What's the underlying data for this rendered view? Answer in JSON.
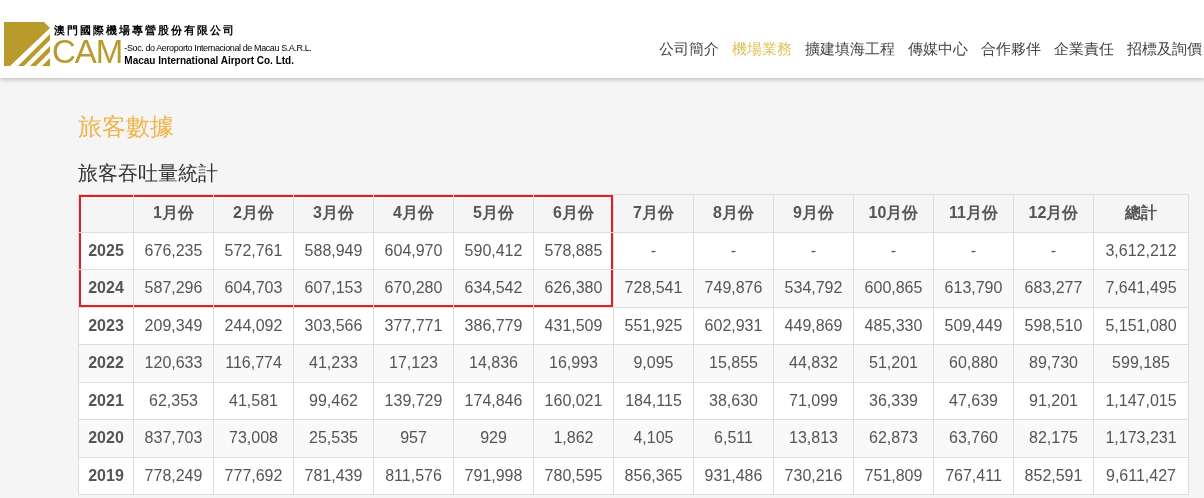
{
  "logo": {
    "chinese_name": "澳門國際機場專營股份有限公司",
    "letters": "CAM",
    "portuguese_name": "-Soc. do Aeroporto Internacional de Macau S.A.R.L.",
    "english_name": "Macau International Airport Co. Ltd."
  },
  "nav": [
    {
      "label": "公司簡介",
      "selected": false
    },
    {
      "label": "機場業務",
      "selected": true
    },
    {
      "label": "擴建填海工程",
      "selected": false
    },
    {
      "label": "傳媒中心",
      "selected": false
    },
    {
      "label": "合作夥伴",
      "selected": false
    },
    {
      "label": "企業責任",
      "selected": false
    },
    {
      "label": "招標及詢價",
      "selected": false
    }
  ],
  "page_title": "旅客數據",
  "section_title": "旅客吞吐量統計",
  "table": {
    "columns": [
      {
        "label": "1月份",
        "highlighted": true
      },
      {
        "label": "2月份",
        "highlighted": true
      },
      {
        "label": "3月份",
        "highlighted": true
      },
      {
        "label": "4月份",
        "highlighted": true
      },
      {
        "label": "5月份",
        "highlighted": true
      },
      {
        "label": "6月份",
        "highlighted": true
      },
      {
        "label": "7月份",
        "highlighted": false
      },
      {
        "label": "8月份",
        "highlighted": false
      },
      {
        "label": "9月份",
        "highlighted": false
      },
      {
        "label": "10月份",
        "highlighted": false
      },
      {
        "label": "11月份",
        "highlighted": false
      },
      {
        "label": "12月份",
        "highlighted": false
      },
      {
        "label": "總計",
        "highlighted": false
      }
    ],
    "rows": [
      {
        "year": "2025",
        "highlighted": true,
        "cells": [
          "676,235",
          "572,761",
          "588,949",
          "604,970",
          "590,412",
          "578,885",
          "-",
          "-",
          "-",
          "-",
          "-",
          "-",
          "3,612,212"
        ]
      },
      {
        "year": "2024",
        "highlighted": true,
        "cells": [
          "587,296",
          "604,703",
          "607,153",
          "670,280",
          "634,542",
          "626,380",
          "728,541",
          "749,876",
          "534,792",
          "600,865",
          "613,790",
          "683,277",
          "7,641,495"
        ]
      },
      {
        "year": "2023",
        "highlighted": false,
        "cells": [
          "209,349",
          "244,092",
          "303,566",
          "377,771",
          "386,779",
          "431,509",
          "551,925",
          "602,931",
          "449,869",
          "485,330",
          "509,449",
          "598,510",
          "5,151,080"
        ]
      },
      {
        "year": "2022",
        "highlighted": false,
        "cells": [
          "120,633",
          "116,774",
          "41,233",
          "17,123",
          "14,836",
          "16,993",
          "9,095",
          "15,855",
          "44,832",
          "51,201",
          "60,880",
          "89,730",
          "599,185"
        ]
      },
      {
        "year": "2021",
        "highlighted": false,
        "cells": [
          "62,353",
          "41,581",
          "99,462",
          "139,729",
          "174,846",
          "160,021",
          "184,115",
          "38,630",
          "71,099",
          "36,339",
          "47,639",
          "91,201",
          "1,147,015"
        ]
      },
      {
        "year": "2020",
        "highlighted": false,
        "cells": [
          "837,703",
          "73,008",
          "25,535",
          "957",
          "929",
          "1,862",
          "4,105",
          "6,511",
          "13,813",
          "62,873",
          "63,760",
          "82,175",
          "1,173,231"
        ]
      },
      {
        "year": "2019",
        "highlighted": false,
        "cells": [
          "778,249",
          "777,692",
          "781,439",
          "811,576",
          "791,998",
          "780,595",
          "856,365",
          "931,486",
          "730,216",
          "751,809",
          "767,411",
          "852,591",
          "9,611,427"
        ]
      }
    ]
  }
}
